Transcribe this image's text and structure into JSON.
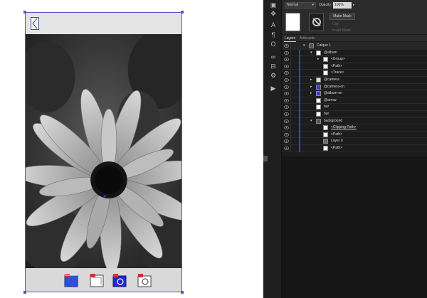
{
  "properties": {
    "blend_mode": "Normal",
    "opacity_label": "Opacity:",
    "opacity_value": "100%",
    "make_mask_label": "Make Mask",
    "clip_label": "Clip",
    "invert_mask_label": "Invert Mask"
  },
  "tabs": [
    {
      "label": "Layers",
      "active": true
    },
    {
      "label": "Artboards",
      "active": false
    }
  ],
  "layers": [
    {
      "name": "Calque 1",
      "depth": 0,
      "expanded": true
    },
    {
      "name": "@album",
      "depth": 1,
      "expanded": true
    },
    {
      "name": "<Group>",
      "depth": 2,
      "expanded": false
    },
    {
      "name": "<Path>",
      "depth": 2
    },
    {
      "name": "<Trace>",
      "depth": 2
    },
    {
      "name": "@camera",
      "depth": 1,
      "expanded": false
    },
    {
      "name": "@camera-on",
      "depth": 1,
      "expanded": false
    },
    {
      "name": "@album-on",
      "depth": 1,
      "expanded": false
    },
    {
      "name": "@arrow",
      "depth": 1
    },
    {
      "name": "bar",
      "depth": 1
    },
    {
      "name": "bar",
      "depth": 1
    },
    {
      "name": "background",
      "depth": 1,
      "expanded": true
    },
    {
      "name": "<Clipping Path>",
      "depth": 2,
      "underline": true
    },
    {
      "name": "<Path>",
      "depth": 2
    },
    {
      "name": "Layer 0",
      "depth": 2
    },
    {
      "name": "<Path>",
      "depth": 2
    }
  ],
  "tools": [
    "select-icon",
    "type-icon",
    "paragraph-icon",
    "glyph-icon",
    "link-icon",
    "transform-icon",
    "shape-icon",
    "play-icon"
  ],
  "colors": {
    "artboard_border": "#5a57c7",
    "panel_bg": "#262626",
    "accent_blue": "#3b3be0",
    "footer_album": "#2f4fd9",
    "footer_camera": "#2424d6"
  }
}
